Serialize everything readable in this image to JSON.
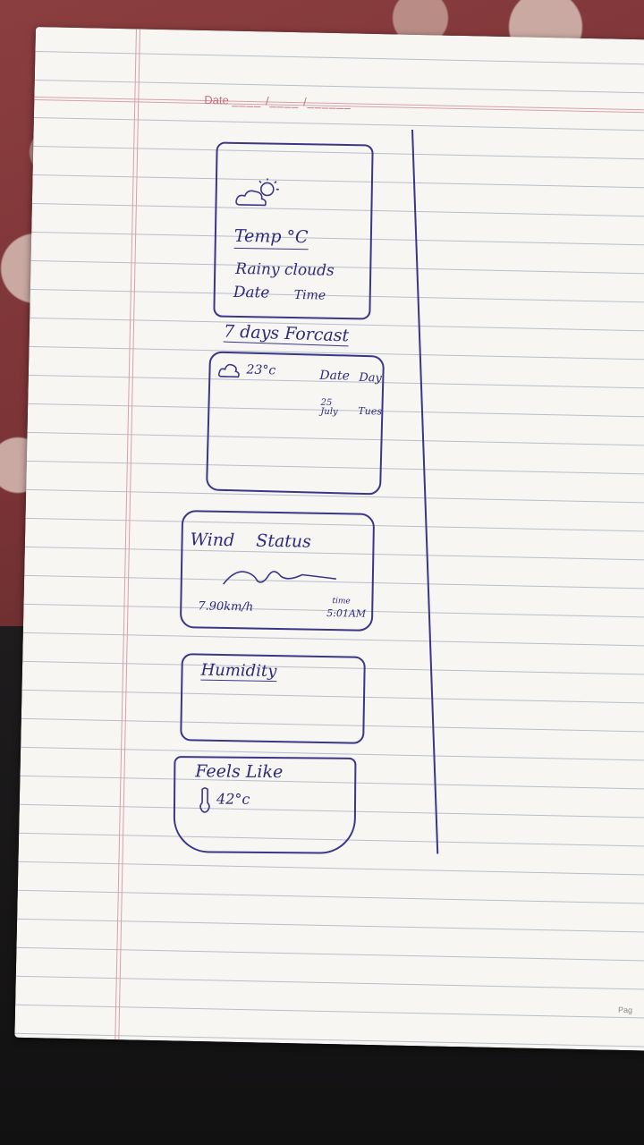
{
  "paper": {
    "date_label": "Date",
    "date_blanks": "____ /____ /______",
    "corner_label": "Pag"
  },
  "current": {
    "icon": "sun-cloud-icon",
    "temp": "Temp °C",
    "description": "Rainy clouds",
    "date": "Date",
    "time": "Time"
  },
  "forecast": {
    "title": "7 days Forcast",
    "icon": "cloud-icon",
    "temp": "23°c",
    "date_header": "Date",
    "day_header": "Day",
    "date_value": "25 July",
    "day_value": "Tues"
  },
  "wind": {
    "title": "Wind Status",
    "speed": "7.90km/h",
    "time_label": "time",
    "time_value": "5:01AM"
  },
  "humidity": {
    "title": "Humidity"
  },
  "feels_like": {
    "title": "Feels Like",
    "icon": "thermometer-icon",
    "value": "42°c"
  }
}
